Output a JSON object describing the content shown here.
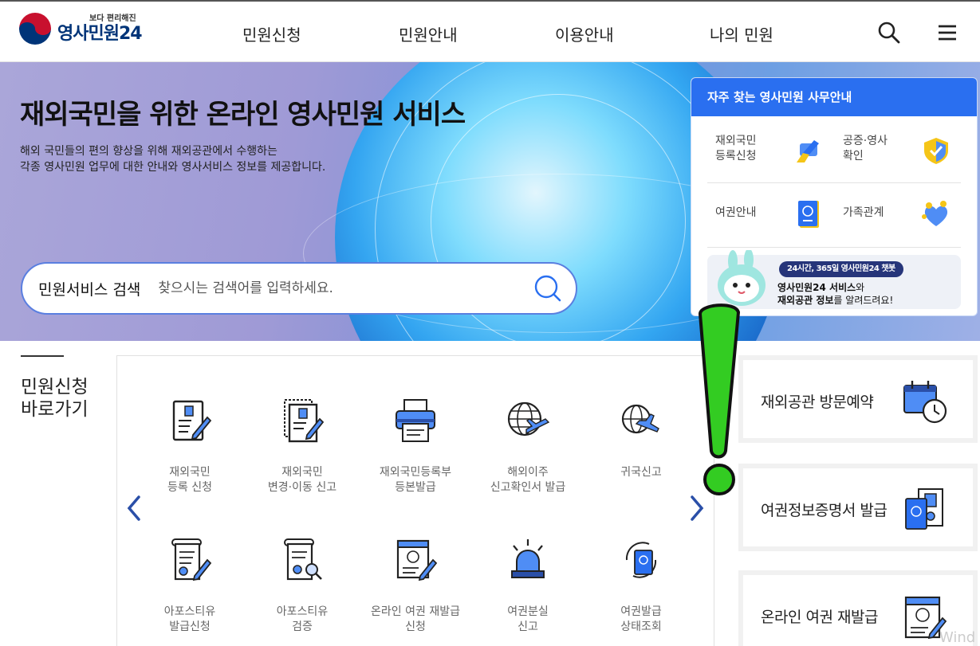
{
  "header": {
    "logo_small": "보다 편리해진",
    "logo_main": "영사민원24",
    "nav": [
      "민원신청",
      "민원안내",
      "이용안내",
      "나의 민원"
    ]
  },
  "hero": {
    "title": "재외국민을 위한 온라인 영사민원 서비스",
    "desc_line1": "해외 국민들의 편의 향상을 위해 재외공관에서 수행하는",
    "desc_line2": "각종 영사민원 업무에 대한 안내와 영사서비스 정보를 제공합니다.",
    "search_label": "민원서비스 검색",
    "search_placeholder": "찾으시는 검색어를 입력하세요."
  },
  "panel": {
    "title": "자주 찾는 영사민원 사무안내",
    "items": [
      {
        "label": "재외국민\n등록신청",
        "icon": "registration-pen-icon"
      },
      {
        "label": "공증·영사\n확인",
        "icon": "shield-check-icon"
      },
      {
        "label": "여권안내",
        "icon": "passport-icon"
      },
      {
        "label": "가족관계",
        "icon": "family-heart-icon"
      }
    ],
    "banner_pill": "24시간, 365일 영사민원24 챗봇",
    "banner_line1_bold": "영사민원24 서비스",
    "banner_line1_rest": "와",
    "banner_line2_bold": "재외공관 정보",
    "banner_line2_rest": "를 알려드려요!"
  },
  "section": {
    "title": "민원신청\n바로가기"
  },
  "services": [
    {
      "label": "재외국민\n등록 신청",
      "icon": "registration-form-icon"
    },
    {
      "label": "재외국민\n변경·이동 신고",
      "icon": "change-form-icon"
    },
    {
      "label": "재외국민등록부\n등본발급",
      "icon": "printer-icon"
    },
    {
      "label": "해외이주\n신고확인서 발급",
      "icon": "globe-plane-icon"
    },
    {
      "label": "귀국신고",
      "icon": "return-plane-icon"
    },
    {
      "label": "아포스티유\n발급신청",
      "icon": "apostille-scroll-icon"
    },
    {
      "label": "아포스티유\n검증",
      "icon": "apostille-verify-icon"
    },
    {
      "label": "온라인 여권 재발급\n신청",
      "icon": "online-passport-icon"
    },
    {
      "label": "여권분실\n신고",
      "icon": "alarm-siren-icon"
    },
    {
      "label": "여권발급\n상태조회",
      "icon": "passport-status-icon"
    }
  ],
  "cards": [
    {
      "label": "재외공관 방문예약",
      "icon": "calendar-clock-icon"
    },
    {
      "label": "여권정보증명서 발급",
      "icon": "passport-certificate-icon"
    },
    {
      "label": "온라인 여권 재발급",
      "icon": "online-reissue-icon"
    }
  ],
  "watermark": "Wind",
  "colors": {
    "brand_blue": "#2a6ff0",
    "navy": "#003478",
    "accent_green": "#33cc22"
  }
}
